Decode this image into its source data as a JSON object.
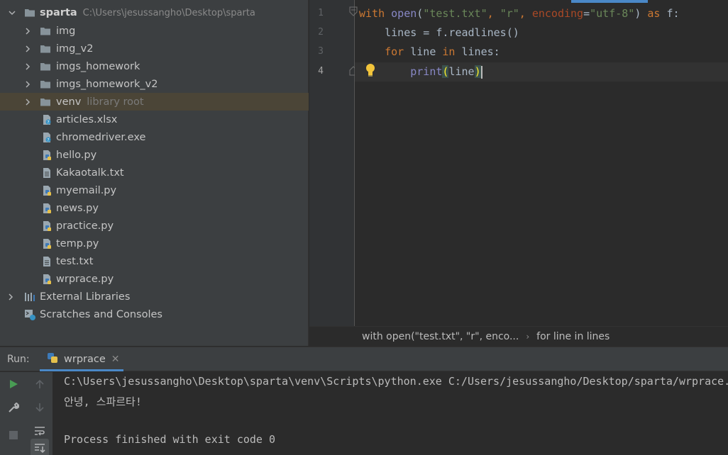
{
  "project": {
    "root": {
      "name": "sparta",
      "path": "C:\\Users\\jesussangho\\Desktop\\sparta"
    },
    "folders": [
      {
        "name": "img"
      },
      {
        "name": "img_v2"
      },
      {
        "name": "imgs_homework"
      },
      {
        "name": "imgs_homework_v2"
      },
      {
        "name": "venv",
        "hint": "library root"
      }
    ],
    "files": [
      {
        "name": "articles.xlsx",
        "icon": "unknown-file-icon"
      },
      {
        "name": "chromedriver.exe",
        "icon": "unknown-file-icon"
      },
      {
        "name": "hello.py",
        "icon": "python-file-icon"
      },
      {
        "name": "Kakaotalk.txt",
        "icon": "text-file-icon"
      },
      {
        "name": "myemail.py",
        "icon": "python-file-icon"
      },
      {
        "name": "news.py",
        "icon": "python-file-icon"
      },
      {
        "name": "practice.py",
        "icon": "python-file-icon"
      },
      {
        "name": "temp.py",
        "icon": "python-file-icon"
      },
      {
        "name": "test.txt",
        "icon": "text-file-icon"
      },
      {
        "name": "wrprace.py",
        "icon": "python-file-icon"
      }
    ],
    "external_libraries": "External Libraries",
    "scratches": "Scratches and Consoles"
  },
  "editor": {
    "line_numbers": [
      "1",
      "2",
      "3",
      "4"
    ],
    "lines": {
      "l1": {
        "kw_with": "with",
        "fn_open": "open",
        "p1": "(",
        "s1": "\"test.txt\"",
        "c1": ", ",
        "s2": "\"r\"",
        "c2": ", ",
        "param": "encoding",
        "eq": "=",
        "s3": "\"utf-8\"",
        "p2": ")",
        "kw_as": " as",
        "tail": " f:"
      },
      "l2": {
        "indent": "    ",
        "text": "lines = f.readlines()"
      },
      "l3": {
        "indent": "    ",
        "kw_for": "for",
        "mid": " line ",
        "kw_in": "in",
        "tail": " lines:"
      },
      "l4": {
        "indent": "        ",
        "fn_print": "print",
        "open": "(",
        "arg": "line",
        "close": ")"
      }
    },
    "breadcrumb": [
      "with open(\"test.txt\", \"r\", enco...",
      "for line in lines"
    ]
  },
  "run": {
    "title": "Run:",
    "tab_label": "wrprace",
    "output": [
      "C:\\Users\\jesussangho\\Desktop\\sparta\\venv\\Scripts\\python.exe C:/Users/jesussangho/Desktop/sparta/wrprace.py",
      "안녕, 스파르타!",
      "",
      "Process finished with exit code 0"
    ]
  },
  "colors": {
    "accent": "#4a88c7",
    "keyword": "#cc7832",
    "string": "#6a8759",
    "builtin": "#8888c6",
    "selection_row": "#4b4537"
  }
}
